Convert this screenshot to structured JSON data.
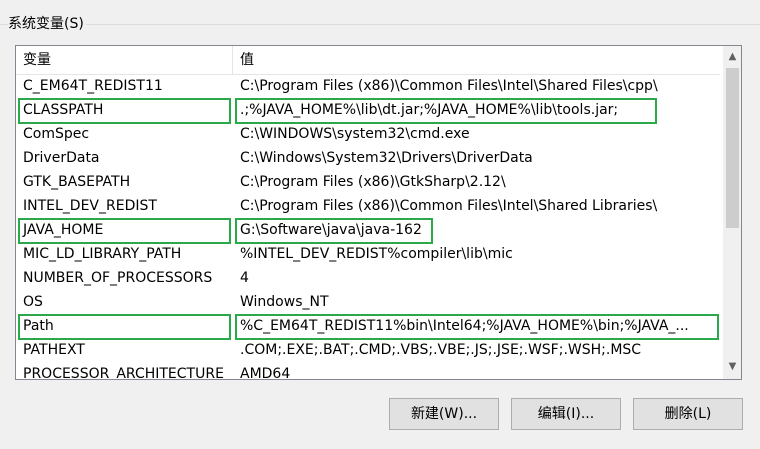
{
  "group": {
    "title": "系统变量(S)"
  },
  "table": {
    "columns": {
      "name": "变量",
      "value": "值"
    },
    "rows": [
      {
        "name": "C_EM64T_REDIST11",
        "value": "C:\\Program Files (x86)\\Common Files\\Intel\\Shared Files\\cpp\\"
      },
      {
        "name": "CLASSPATH",
        "value": ".;%JAVA_HOME%\\lib\\dt.jar;%JAVA_HOME%\\lib\\tools.jar;"
      },
      {
        "name": "ComSpec",
        "value": "C:\\WINDOWS\\system32\\cmd.exe"
      },
      {
        "name": "DriverData",
        "value": "C:\\Windows\\System32\\Drivers\\DriverData"
      },
      {
        "name": "GTK_BASEPATH",
        "value": "C:\\Program Files (x86)\\GtkSharp\\2.12\\"
      },
      {
        "name": "INTEL_DEV_REDIST",
        "value": "C:\\Program Files (x86)\\Common Files\\Intel\\Shared Libraries\\"
      },
      {
        "name": "JAVA_HOME",
        "value": "G:\\Software\\java\\java-162"
      },
      {
        "name": "MIC_LD_LIBRARY_PATH",
        "value": "%INTEL_DEV_REDIST%compiler\\lib\\mic"
      },
      {
        "name": "NUMBER_OF_PROCESSORS",
        "value": "4"
      },
      {
        "name": "OS",
        "value": "Windows_NT"
      },
      {
        "name": "Path",
        "value": "%C_EM64T_REDIST11%bin\\Intel64;%JAVA_HOME%\\bin;%JAVA_..."
      },
      {
        "name": "PATHEXT",
        "value": ".COM;.EXE;.BAT;.CMD;.VBS;.VBE;.JS;.JSE;.WSF;.WSH;.MSC"
      },
      {
        "name": "PROCESSOR_ARCHITECTURE",
        "value": "AMD64"
      }
    ]
  },
  "highlight_color": "#2aa84a",
  "scrollbar": {
    "up_icon": "chevron-up-icon",
    "down_icon": "chevron-down-icon"
  },
  "buttons": {
    "new_label": "新建(W)...",
    "edit_label": "编辑(I)...",
    "delete_label": "删除(L)"
  }
}
